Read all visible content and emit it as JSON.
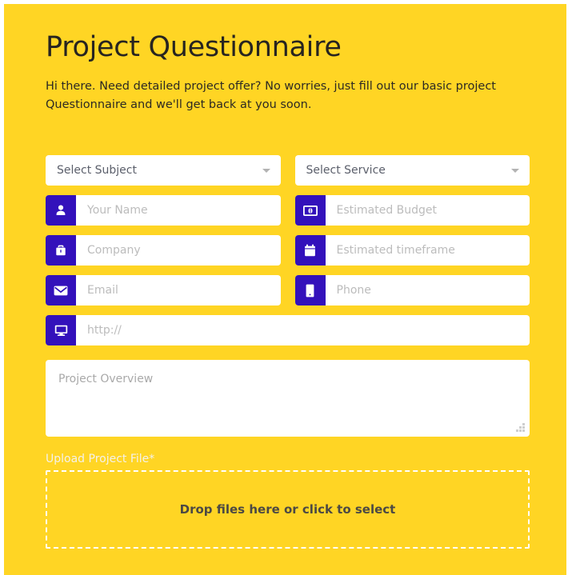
{
  "theme": {
    "background": "#FFD524",
    "accent": "#3311BB",
    "field_background": "#FFFFFF",
    "title_color": "#272420",
    "placeholder_color": "#BCBCBC",
    "dropzone_border": "#FFFFFF"
  },
  "header": {
    "title": "Project Questionnaire",
    "intro": "Hi there. Need detailed project offer? No worries, just fill out our basic project Questionnaire and we'll get back at you soon."
  },
  "form": {
    "selects": [
      {
        "name": "subject",
        "value": "Select Subject",
        "caret_icon": "chevron-down-icon"
      },
      {
        "name": "service",
        "value": "Select Service",
        "caret_icon": "chevron-down-icon"
      }
    ],
    "fields": [
      {
        "name": "your-name",
        "placeholder": "Your Name",
        "value": "",
        "icon": "user-icon"
      },
      {
        "name": "estimated-budget",
        "placeholder": "Estimated Budget",
        "value": "",
        "icon": "money-bill-icon"
      },
      {
        "name": "company",
        "placeholder": "Company",
        "value": "",
        "icon": "briefcase-icon"
      },
      {
        "name": "estimated-timeframe",
        "placeholder": "Estimated timeframe",
        "value": "",
        "icon": "calendar-icon"
      },
      {
        "name": "email",
        "placeholder": "Email",
        "value": "",
        "icon": "envelope-icon"
      },
      {
        "name": "phone",
        "placeholder": "Phone",
        "value": "",
        "icon": "mobile-phone-icon"
      },
      {
        "name": "website",
        "placeholder": "http://",
        "value": "",
        "icon": "desktop-monitor-icon"
      }
    ],
    "textarea": {
      "name": "project-overview",
      "placeholder": "Project Overview",
      "value": "",
      "resize_handle_icon": "resize-grip-icon"
    },
    "upload": {
      "label": "Upload Project File*",
      "dropzone_text": "Drop files here or click to select"
    }
  }
}
